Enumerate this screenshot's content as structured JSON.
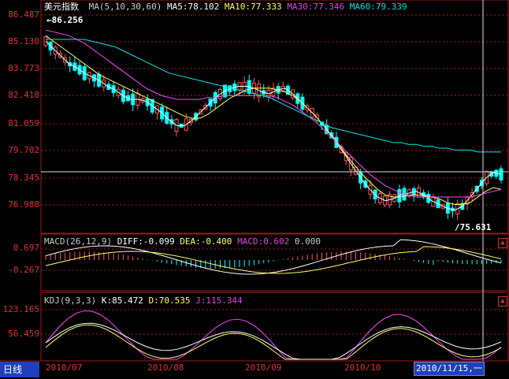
{
  "main": {
    "title": "美元指数",
    "ma_label": "MA(5,10,30,60)",
    "ma5": "MA5:78.102",
    "ma10": "MA10:77.333",
    "ma30": "MA30:77.346",
    "ma60": "MA60:79.339",
    "high_marker": "86.256",
    "low_marker": "75.631",
    "y_ticks": [
      "86.487",
      "85.130",
      "83.773",
      "82.418",
      "81.059",
      "79.702",
      "78.345",
      "76.988"
    ]
  },
  "macd": {
    "label": "MACD(26,12,9)",
    "diff": "DIFF:-0.099",
    "dea": "DEA:-0.400",
    "macd": "MACD:0.602",
    "extra": "0.000",
    "y_ticks": [
      "0.697",
      "-0.267"
    ]
  },
  "kdj": {
    "label": "KDJ(9,3,3)",
    "k": "K:85.472",
    "d": "D:70.535",
    "j": "J:115.344",
    "y_ticks": [
      "123.165",
      "56.459"
    ]
  },
  "bottom": {
    "period": "日线",
    "dates": [
      "2010/07",
      "2010/08",
      "2010/09",
      "2010/10"
    ],
    "cursor_date": "2010/11/15,一"
  },
  "colors": {
    "up": "#ff5555",
    "down": "#00ffff",
    "ma5": "#ffffff",
    "ma10": "#ffff66",
    "ma30": "#ff44ff",
    "ma60": "#00e6e6",
    "grid": "#a01818",
    "axis_text": "#dd3333"
  },
  "chart_data": {
    "type": "candlestick",
    "series": [
      {
        "name": "MA5",
        "values": [
          85.2,
          84.8,
          84.4,
          84.0,
          83.8,
          83.5,
          83.3,
          83.1,
          82.8,
          82.6,
          82.3,
          82.1,
          82.1,
          82.0,
          81.7,
          81.4,
          81.0,
          80.7,
          80.7,
          81.0,
          81.4,
          81.8,
          82.2,
          82.5,
          82.7,
          82.8,
          82.8,
          82.7,
          82.5,
          82.4,
          82.6,
          82.7,
          82.4,
          82.0,
          81.6,
          81.2,
          80.7,
          80.2,
          79.6,
          79.0,
          78.4,
          77.8,
          77.3,
          76.9,
          76.7,
          76.8,
          77.0,
          77.1,
          77.2,
          77.0,
          76.7,
          76.5,
          76.3,
          76.2,
          76.4,
          76.9,
          77.4,
          77.9,
          78.2,
          78.1
        ]
      },
      {
        "name": "MA10",
        "values": [
          85.5,
          85.2,
          84.9,
          84.6,
          84.3,
          84.0,
          83.7,
          83.4,
          83.2,
          83.0,
          82.8,
          82.6,
          82.4,
          82.2,
          82.0,
          81.8,
          81.6,
          81.4,
          81.2,
          81.1,
          81.1,
          81.3,
          81.6,
          81.9,
          82.2,
          82.4,
          82.6,
          82.7,
          82.7,
          82.7,
          82.6,
          82.5,
          82.3,
          82.0,
          81.6,
          81.2,
          80.7,
          80.2,
          79.7,
          79.1,
          78.6,
          78.1,
          77.7,
          77.3,
          77.0,
          76.9,
          76.9,
          77.0,
          77.0,
          77.0,
          76.9,
          76.8,
          76.6,
          76.5,
          76.5,
          76.6,
          76.9,
          77.2,
          77.4,
          77.3
        ]
      },
      {
        "name": "MA30",
        "values": [
          85.8,
          85.7,
          85.6,
          85.5,
          85.3,
          85.1,
          84.8,
          84.5,
          84.2,
          83.9,
          83.6,
          83.3,
          83.0,
          82.7,
          82.5,
          82.3,
          82.2,
          82.1,
          82.1,
          82.1,
          82.1,
          82.2,
          82.2,
          82.3,
          82.3,
          82.3,
          82.3,
          82.3,
          82.3,
          82.3,
          82.2,
          82.0,
          81.8,
          81.5,
          81.2,
          80.9,
          80.5,
          80.1,
          79.7,
          79.3,
          78.9,
          78.5,
          78.1,
          77.8,
          77.5,
          77.3,
          77.1,
          77.0,
          76.9,
          76.9,
          76.9,
          76.9,
          76.9,
          76.9,
          76.9,
          76.9,
          77.0,
          77.1,
          77.2,
          77.3
        ]
      },
      {
        "name": "MA60",
        "values": [
          85.3,
          85.3,
          85.3,
          85.3,
          85.3,
          85.3,
          85.2,
          85.1,
          85.0,
          84.9,
          84.7,
          84.5,
          84.3,
          84.1,
          83.9,
          83.7,
          83.5,
          83.4,
          83.3,
          83.2,
          83.1,
          83.0,
          82.9,
          82.8,
          82.7,
          82.6,
          82.5,
          82.4,
          82.3,
          82.2,
          82.0,
          81.8,
          81.6,
          81.4,
          81.2,
          81.0,
          80.8,
          80.6,
          80.5,
          80.4,
          80.3,
          80.2,
          80.1,
          80.0,
          79.9,
          79.8,
          79.8,
          79.7,
          79.7,
          79.6,
          79.6,
          79.5,
          79.5,
          79.4,
          79.4,
          79.4,
          79.3,
          79.3,
          79.3,
          79.3
        ]
      }
    ],
    "high": 86.256,
    "low": 75.631,
    "ylim": [
      76.0,
      86.487
    ]
  }
}
